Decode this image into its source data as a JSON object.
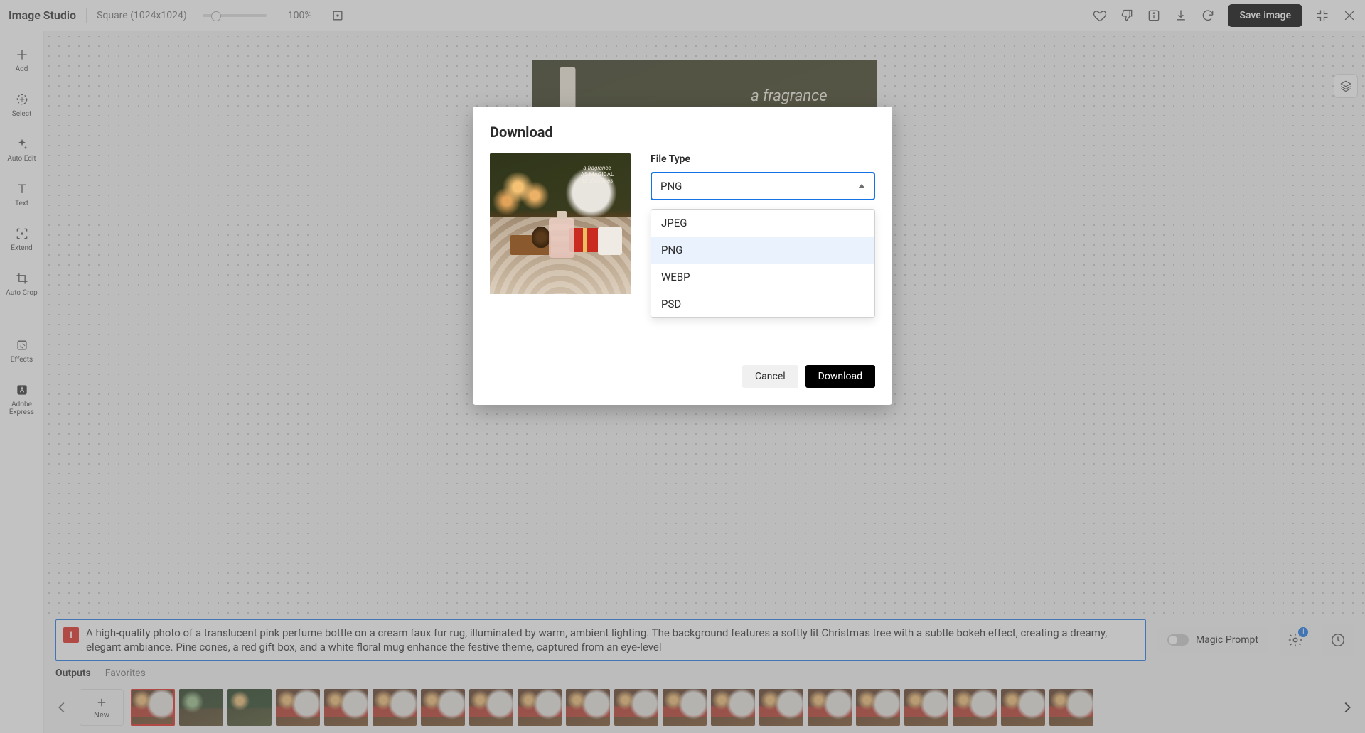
{
  "header": {
    "title": "Image Studio",
    "dimensions": "Square (1024x1024)",
    "zoom": "100%",
    "save_label": "Save image"
  },
  "sidebar": {
    "items": [
      {
        "label": "Add"
      },
      {
        "label": "Select"
      },
      {
        "label": "Auto Edit"
      },
      {
        "label": "Text"
      },
      {
        "label": "Extend"
      },
      {
        "label": "Auto Crop"
      },
      {
        "label": "Effects"
      },
      {
        "label": "Adobe Express"
      }
    ]
  },
  "canvas": {
    "overlay_text": {
      "line1": "a fragrance",
      "line2": "AS MAGICAL",
      "line3": "as christmas"
    }
  },
  "prompt": {
    "brand_initial": "I",
    "text": "A high-quality photo of a translucent pink perfume bottle on a cream faux fur rug, illuminated by warm, ambient lighting. The background features a softly lit Christmas tree with a subtle bokeh effect, creating a dreamy, elegant ambiance. Pine cones, a red gift box, and a white floral mug enhance the festive theme, captured from an eye-level",
    "magic_label": "Magic Prompt",
    "settings_badge": "1"
  },
  "tabs": {
    "outputs": "Outputs",
    "favorites": "Favorites"
  },
  "thumbs": {
    "new_label": "New",
    "count": 20,
    "selected_index": 0
  },
  "modal": {
    "title": "Download",
    "field_label": "File Type",
    "selected": "PNG",
    "options": [
      "JPEG",
      "PNG",
      "WEBP",
      "PSD"
    ],
    "cancel": "Cancel",
    "download": "Download",
    "preview_text": {
      "line1": "a fragrance",
      "line2": "AS MAGICAL",
      "line3": "as christmas"
    }
  }
}
